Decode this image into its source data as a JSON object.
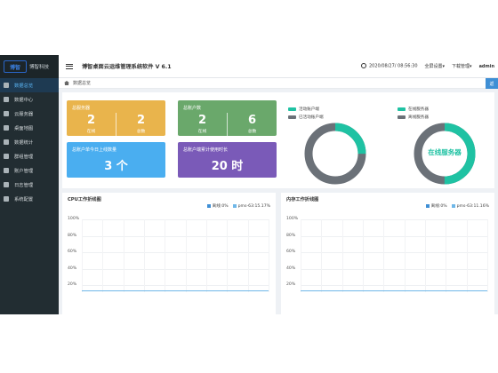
{
  "sidebar": {
    "logo_mark": "博智",
    "brand": "博智科技",
    "items": [
      {
        "label": "数据总览",
        "icon": "dashboard-icon",
        "active": true
      },
      {
        "label": "数据中心",
        "icon": "database-icon"
      },
      {
        "label": "云服务器",
        "icon": "server-icon"
      },
      {
        "label": "桌面地图",
        "icon": "map-pin-icon"
      },
      {
        "label": "数据统计",
        "icon": "chart-icon"
      },
      {
        "label": "群组管理",
        "icon": "group-icon"
      },
      {
        "label": "账户管理",
        "icon": "id-card-icon"
      },
      {
        "label": "日志管理",
        "icon": "log-icon"
      },
      {
        "label": "系统配置",
        "icon": "settings-icon"
      }
    ]
  },
  "header": {
    "title": "博智桌面云运维管理系统软件 V 6.1",
    "datetime": "2020/08/27/ 08:56:30",
    "fullscreen": "全屏设置▾",
    "download": "下载管理▾",
    "user": "admin"
  },
  "breadcrumb": {
    "label": "数据总览",
    "button": "返"
  },
  "cards": {
    "servers": {
      "title": "总服务器",
      "online": "2",
      "online_label": "在线",
      "total": "2",
      "total_label": "总数",
      "color": "#e9b44c"
    },
    "accounts": {
      "title": "总账户数",
      "online": "2",
      "online_label": "在线",
      "total": "6",
      "total_label": "总数",
      "color": "#6aa86b"
    },
    "daily": {
      "title": "总账户单今日上线数量",
      "value": "3 个",
      "color": "#4aaef0"
    },
    "hours": {
      "title": "总账户端累计使用时长",
      "value": "20 时",
      "color": "#7a5ab8"
    }
  },
  "donut_accounts": {
    "legend": [
      "活动账户端",
      "已活动账户端"
    ],
    "colors": [
      "#1fc2a3",
      "#6b7178"
    ],
    "values": [
      2,
      6
    ]
  },
  "donut_servers": {
    "legend": [
      "在线服务器",
      "离线服务器"
    ],
    "colors": [
      "#1fc2a3",
      "#6b7178"
    ],
    "values": [
      2,
      2
    ],
    "center_label": "在线服务器"
  },
  "cpu_panel": {
    "title": "CPU工作折线图",
    "legend": [
      "离线:0%",
      "pms-63:15.17%"
    ],
    "legend_colors": [
      "#3f8fd5",
      "#6fb7e8"
    ],
    "yticks": [
      "100%",
      "80%",
      "60%",
      "40%",
      "20%"
    ]
  },
  "mem_panel": {
    "title": "内存工作折线图",
    "legend": [
      "离线:0%",
      "pms-63:11.16%"
    ],
    "legend_colors": [
      "#3f8fd5",
      "#6fb7e8"
    ],
    "yticks": [
      "100%",
      "80%",
      "60%",
      "40%",
      "20%"
    ]
  }
}
